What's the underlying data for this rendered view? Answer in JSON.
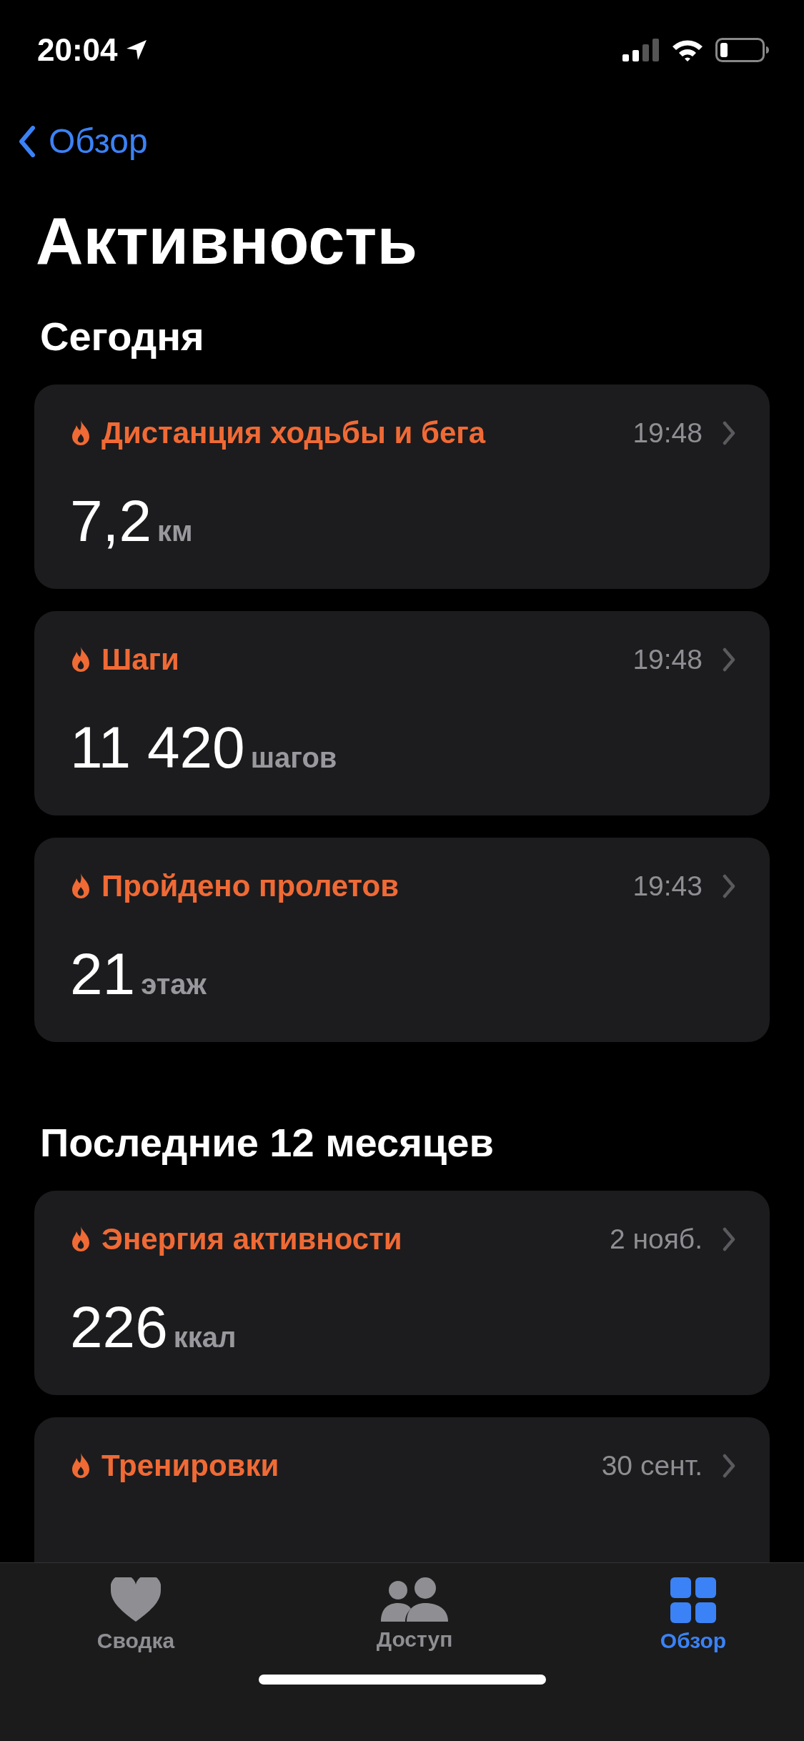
{
  "status_bar": {
    "time": "20:04"
  },
  "nav": {
    "back": "Обзор"
  },
  "title": "Активность",
  "sections": [
    {
      "heading": "Сегодня",
      "cards": [
        {
          "title": "Дистанция ходьбы и бега",
          "time": "19:48",
          "value": "7,2",
          "unit": "км"
        },
        {
          "title": "Шаги",
          "time": "19:48",
          "value": "11 420",
          "unit": "шагов"
        },
        {
          "title": "Пройдено пролетов",
          "time": "19:43",
          "value": "21",
          "unit": "этаж"
        }
      ]
    },
    {
      "heading": "Последние 12 месяцев",
      "cards": [
        {
          "title": "Энергия активности",
          "time": "2 нояб.",
          "value": "226",
          "unit": "ккал"
        },
        {
          "title": "Тренировки",
          "time": "30 сент."
        }
      ]
    }
  ],
  "tab_bar": [
    {
      "label": "Сводка",
      "kind": "heart",
      "selected": false
    },
    {
      "label": "Доступ",
      "kind": "people",
      "selected": false
    },
    {
      "label": "Обзор",
      "kind": "grid",
      "selected": true
    }
  ]
}
